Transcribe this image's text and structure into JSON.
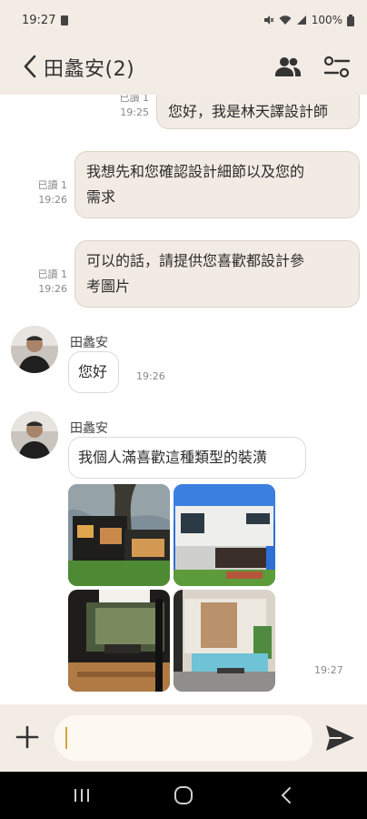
{
  "status_bar": {
    "time": "19:27",
    "battery": "100%"
  },
  "header": {
    "title": "田蠡安(2)"
  },
  "messages": {
    "out1": {
      "read": "已讀 1",
      "time": "19:25",
      "text": "您好，我是林天譯設計師"
    },
    "out2": {
      "read": "已讀 1",
      "time": "19:26",
      "line1": "我想先和您確認設計細節以及您的",
      "line2": "需求"
    },
    "out3": {
      "read": "已讀 1",
      "time": "19:26",
      "line1": "可以的話，請提供您喜歡都設計參",
      "line2": "考圖片"
    },
    "in1": {
      "sender": "田蠡安",
      "text": "您好",
      "time": "19:26"
    },
    "in2": {
      "sender": "田蠡安",
      "text": "我個人滿喜歡這種類型的裝潢",
      "time": "19:27"
    }
  },
  "input": {
    "value": "",
    "placeholder": ""
  },
  "colors": {
    "header_bg": "#f3ece5",
    "outgoing_bubble": "#f2ebe3",
    "caret": "#d8a43a"
  },
  "icons": [
    "back-arrow-icon",
    "members-icon",
    "settings-icon",
    "plus-icon",
    "send-icon",
    "recent-apps-icon",
    "home-icon",
    "back-icon"
  ]
}
